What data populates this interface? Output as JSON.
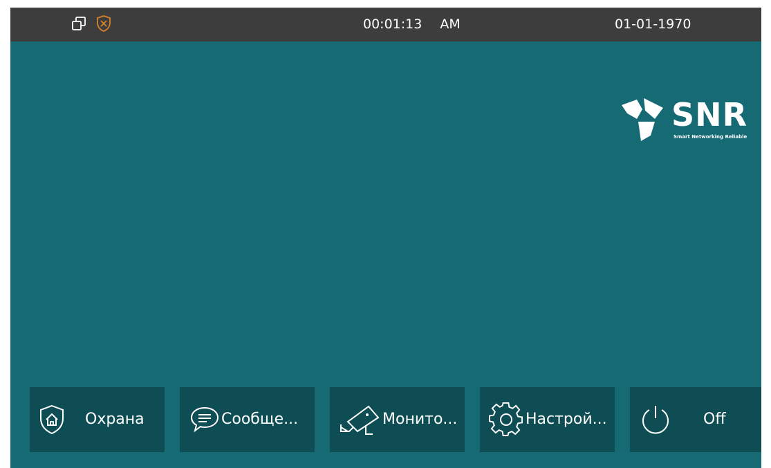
{
  "statusbar": {
    "time": "00:01:13",
    "ampm": "AM",
    "date": "01-01-1970",
    "icons": [
      "windows-icon",
      "shield-x-icon"
    ]
  },
  "brand": {
    "name": "SNR",
    "tagline": "Smart Networking Reliable"
  },
  "dock": [
    {
      "label": "Охрана",
      "icon": "shield-home-icon"
    },
    {
      "label": "Сообще...",
      "icon": "chat-bubble-icon"
    },
    {
      "label": "Монито...",
      "icon": "cctv-camera-icon"
    },
    {
      "label": "Настрой...",
      "icon": "gear-icon"
    },
    {
      "label": "Off",
      "icon": "power-icon"
    }
  ],
  "colors": {
    "background": "#156a73",
    "statusbar": "#3d3d3d",
    "dock_button": "#0f4d54",
    "shield_accent": "#d9822b"
  }
}
